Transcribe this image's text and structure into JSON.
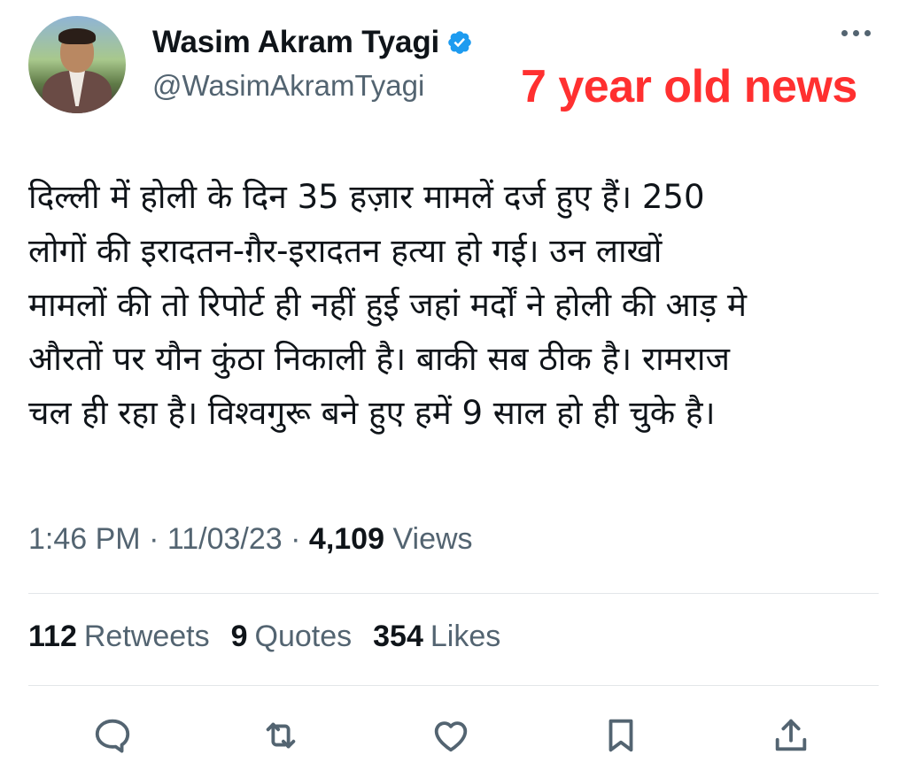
{
  "author": {
    "display_name": "Wasim Akram Tyagi",
    "handle": "@WasimAkramTyagi",
    "verified": true
  },
  "overlay_label": "7 year old news",
  "tweet": {
    "text_lines": [
      "दिल्ली में होली के दिन 35 हज़ार मामलें दर्ज हुए हैं। 250",
      "लोगों की इरादतन-ग़ैर-इरादतन हत्या हो गई। उन लाखों",
      "मामलों की तो रिपोर्ट ही नहीं हुई जहां मर्दों ने होली की आड़ मे",
      "औरतों पर यौन कुंठा निकाली है। बाकी सब ठीक है। रामराज",
      "चल ही रहा है। विश्वगुरू बने हुए हमें 9 साल हो ही चुके है।"
    ]
  },
  "meta": {
    "time": "1:46 PM",
    "date": "11/03/23",
    "views_count": "4,109",
    "views_label": "Views"
  },
  "stats": {
    "retweets_count": "112",
    "retweets_label": "Retweets",
    "quotes_count": "9",
    "quotes_label": "Quotes",
    "likes_count": "354",
    "likes_label": "Likes"
  },
  "icons": {
    "reply": "reply-icon",
    "retweet": "retweet-icon",
    "like": "heart-icon",
    "bookmark": "bookmark-icon",
    "share": "share-icon",
    "more": "more-icon",
    "verified": "verified-badge-icon"
  },
  "colors": {
    "text": "#0f1419",
    "secondary": "#536471",
    "verified": "#1d9bf0",
    "overlay": "#ff3030"
  }
}
